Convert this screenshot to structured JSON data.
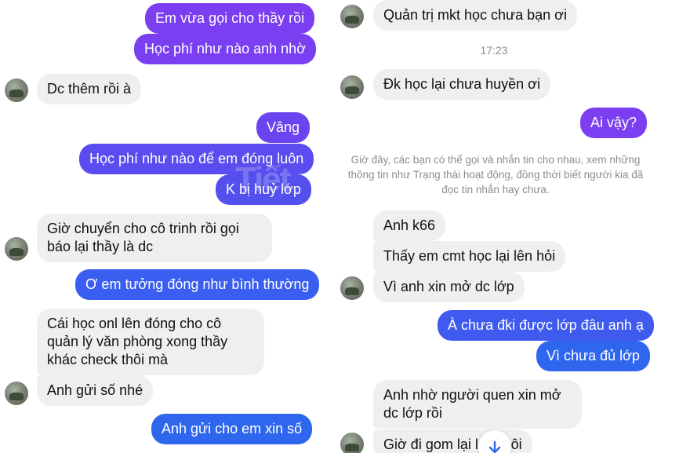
{
  "colors": {
    "outgoing_top": "#7b3ef0",
    "outgoing_bottom": "#2f66ee",
    "incoming": "#efeff1",
    "meta_text": "#8a8d91"
  },
  "left_thread": {
    "messages": [
      {
        "from": "me",
        "text": "Em vừa gọi cho thầy rồi"
      },
      {
        "from": "me",
        "text": "Học phí như nào anh nhờ"
      },
      {
        "from": "them",
        "text": "Dc thêm rồi à"
      },
      {
        "from": "me",
        "text": "Vâng"
      },
      {
        "from": "me",
        "text": "Học phí như nào để em đóng luôn"
      },
      {
        "from": "me",
        "text": "K bị huỷ lớp"
      },
      {
        "from": "them",
        "text": "Giờ chuyển cho cô trinh rồi gọi báo lại thầy là dc"
      },
      {
        "from": "me",
        "text": "Ơ em tưởng đóng như bình thường"
      },
      {
        "from": "them",
        "text": "Cái học onl lên đóng cho cô quản lý văn phòng xong thầy khác check thôi mà"
      },
      {
        "from": "them",
        "text": "Anh gửi số nhé"
      },
      {
        "from": "me",
        "text": "Anh gửi cho em xin số"
      }
    ]
  },
  "right_thread": {
    "messages": [
      {
        "from": "them",
        "text": "Quản trị mkt học chưa bạn ơi"
      },
      {
        "from": "them",
        "text": "Đk học lại chưa huyền ơi"
      },
      {
        "from": "me",
        "text": "Ai vậy?"
      },
      {
        "from": "them",
        "text": "Anh k66"
      },
      {
        "from": "them",
        "text": "Thấy em cmt học lại lên hỏi"
      },
      {
        "from": "them",
        "text": "Vì anh xin mở dc lớp"
      },
      {
        "from": "me",
        "text": "À chưa đki được lớp đâu anh ạ"
      },
      {
        "from": "me",
        "text": "Vì chưa đủ lớp"
      },
      {
        "from": "them",
        "text": "Anh nhờ người quen xin mở dc lớp rồi"
      },
      {
        "from": "them",
        "text": "Giờ đi gom lại lớp thôi"
      }
    ],
    "timestamp": "17:23",
    "info_note": "Giờ đây, các bạn có thể gọi và nhắn tin cho nhau, xem những thông tin như Trạng thái hoạt động, đồng thời biết người kia đã đọc tin nhắn hay chưa."
  },
  "icons": {
    "avatar": "avatar-icon",
    "scroll_down": "arrow-down-icon"
  }
}
